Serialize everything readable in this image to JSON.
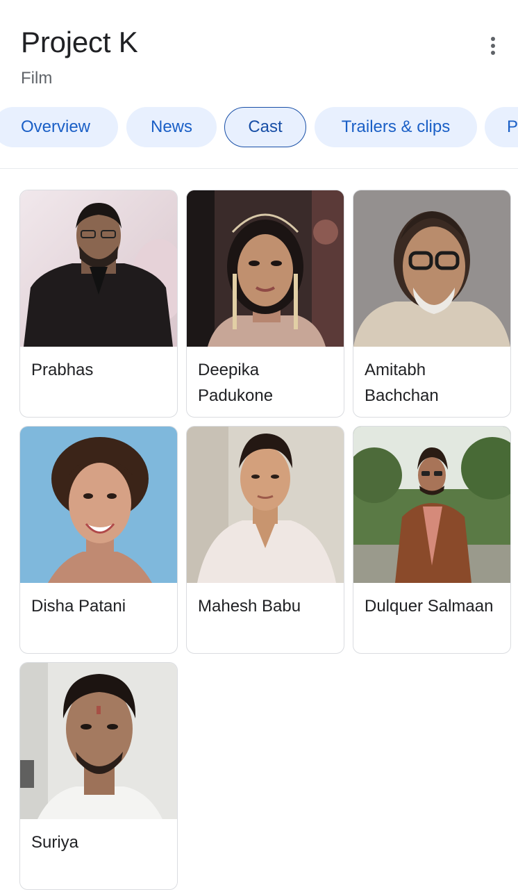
{
  "header": {
    "title": "Project K",
    "subtitle": "Film",
    "more_icon": "more-vert-icon"
  },
  "tabs": [
    {
      "label": "Overview"
    },
    {
      "label": "News"
    },
    {
      "label": "Cast",
      "selected": true
    },
    {
      "label": "Trailers & clips"
    },
    {
      "label": "P"
    }
  ],
  "cast": [
    {
      "name": "Prabhas"
    },
    {
      "name": "Deepika Padukone"
    },
    {
      "name": "Amitabh Bachchan"
    },
    {
      "name": "Disha Patani"
    },
    {
      "name": "Mahesh Babu"
    },
    {
      "name": "Dulquer Salmaan"
    },
    {
      "name": "Suriya"
    }
  ],
  "colors": {
    "tab_bg": "#e8f0fe",
    "tab_text": "#1a5fc6",
    "tab_active_border": "#174ea6",
    "card_border": "#dadce0"
  }
}
